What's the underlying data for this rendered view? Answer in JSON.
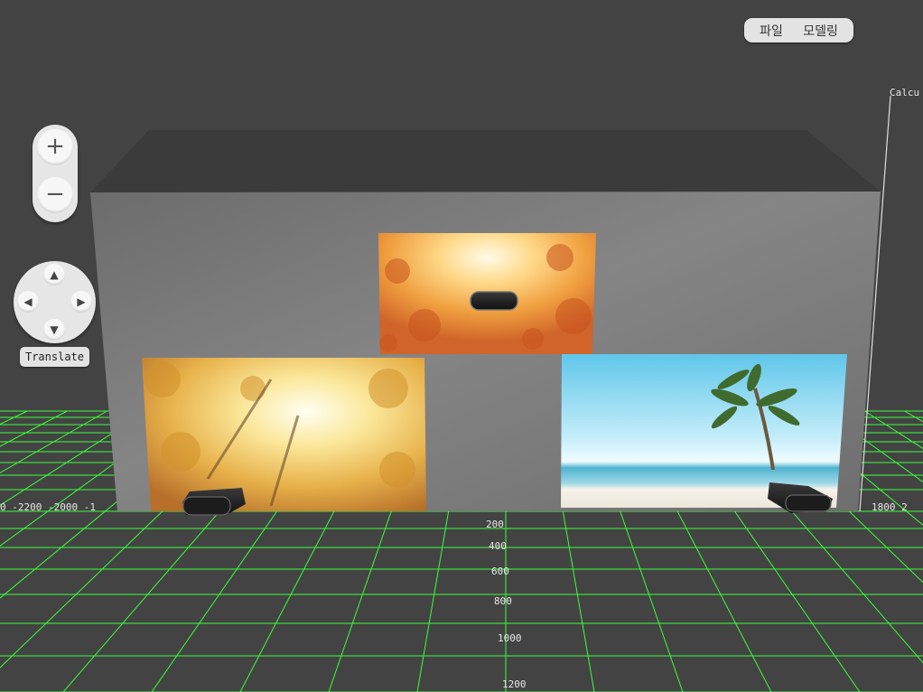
{
  "menu": {
    "file": "파일",
    "modeling": "모델링"
  },
  "zoom": {
    "in": "+",
    "out": "−"
  },
  "nav": {
    "up": "▲",
    "down": "▼",
    "left": "◀",
    "right": "▶",
    "translate_label": "Translate"
  },
  "calc_label": "Calcu",
  "x_axis_labels": {
    "left": "0 -2200 -2000 -1",
    "right": "1800 2"
  },
  "z_axis_labels": [
    "200",
    "400",
    "600",
    "800",
    "1000",
    "1200"
  ],
  "colors": {
    "background": "#434343",
    "grid": "#39ff39",
    "wall": "#7a7a7a",
    "roof": "#3a3a3a"
  },
  "screens": [
    {
      "name": "autumn-leaves-screen",
      "theme": "autumn sunlight through maple leaves"
    },
    {
      "name": "autumn-trees-screen",
      "theme": "looking up through autumn trees"
    },
    {
      "name": "beach-screen",
      "theme": "tropical beach with palm tree"
    }
  ],
  "projectors": 3
}
